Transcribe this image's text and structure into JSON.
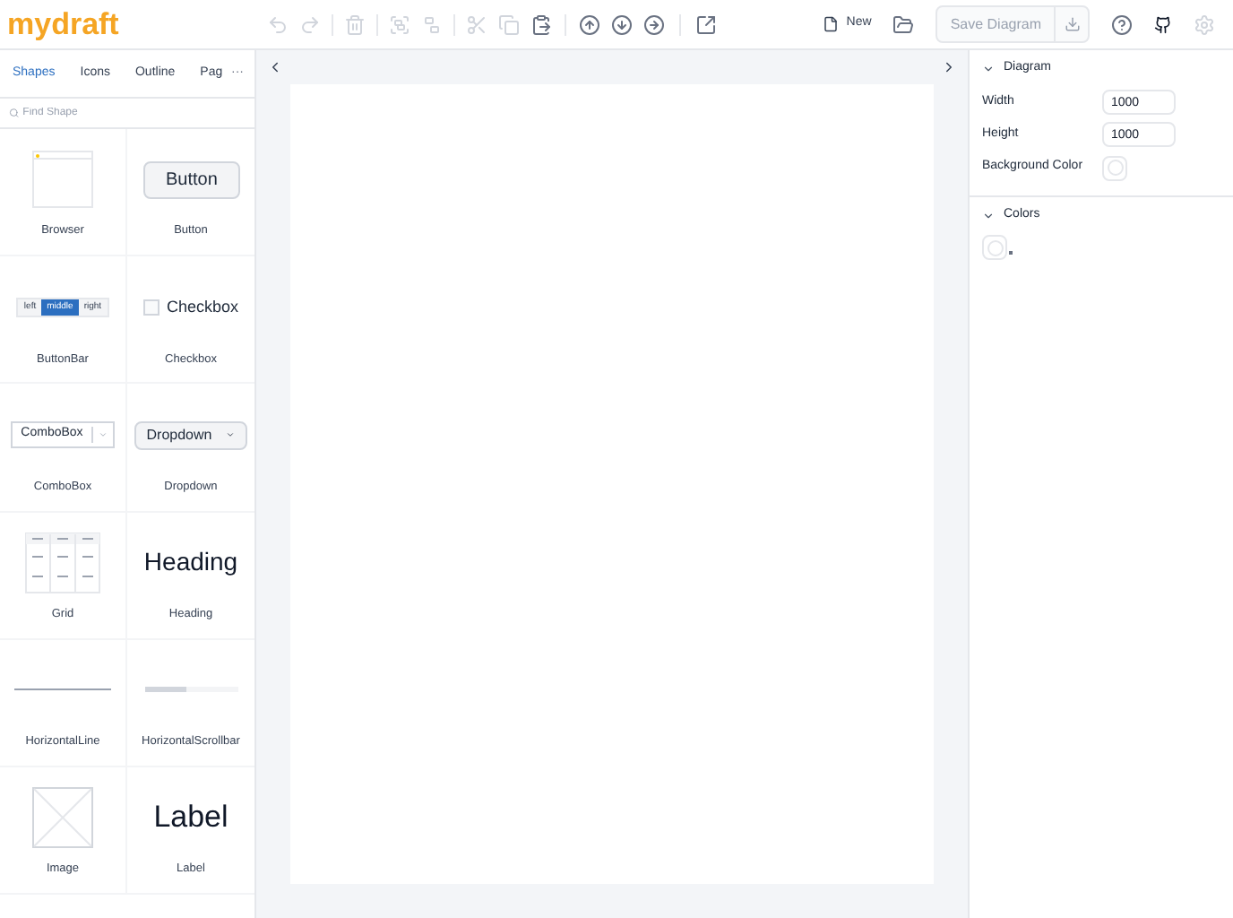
{
  "logo": "mydraft",
  "toolbar": {
    "new_label": "New",
    "save_label": "Save Diagram"
  },
  "tabs": [
    {
      "label": "Shapes",
      "selected": true
    },
    {
      "label": "Icons",
      "selected": false
    },
    {
      "label": "Outline",
      "selected": false
    },
    {
      "label": "Pag",
      "selected": false
    }
  ],
  "more": "···",
  "search": {
    "placeholder": "Find Shape"
  },
  "shapes": [
    {
      "name": "Browser",
      "kind": "browser"
    },
    {
      "name": "Button",
      "kind": "button",
      "preview": [
        "Button"
      ]
    },
    {
      "name": "ButtonBar",
      "kind": "buttonbar",
      "preview": [
        "left",
        "middle",
        "right"
      ]
    },
    {
      "name": "Checkbox",
      "kind": "checkbox",
      "preview": [
        "Checkbox"
      ]
    },
    {
      "name": "ComboBox",
      "kind": "combobox",
      "preview": [
        "ComboBox"
      ]
    },
    {
      "name": "Dropdown",
      "kind": "dropdown",
      "preview": [
        "Dropdown"
      ]
    },
    {
      "name": "Grid",
      "kind": "grid"
    },
    {
      "name": "Heading",
      "kind": "heading",
      "preview": [
        "Heading"
      ]
    },
    {
      "name": "HorizontalLine",
      "kind": "hline"
    },
    {
      "name": "HorizontalScrollbar",
      "kind": "hscroll",
      "level": 0.45
    },
    {
      "name": "Image",
      "kind": "image"
    },
    {
      "name": "Label",
      "kind": "label",
      "preview": [
        "Label"
      ]
    }
  ],
  "properties": {
    "diagram": {
      "title": "Diagram",
      "expanded": true,
      "fields": [
        {
          "label": "Width",
          "value": "1000"
        },
        {
          "label": "Height",
          "value": "1000"
        }
      ],
      "background_label": "Background Color"
    },
    "colors": {
      "title": "Colors",
      "expanded": true
    }
  }
}
